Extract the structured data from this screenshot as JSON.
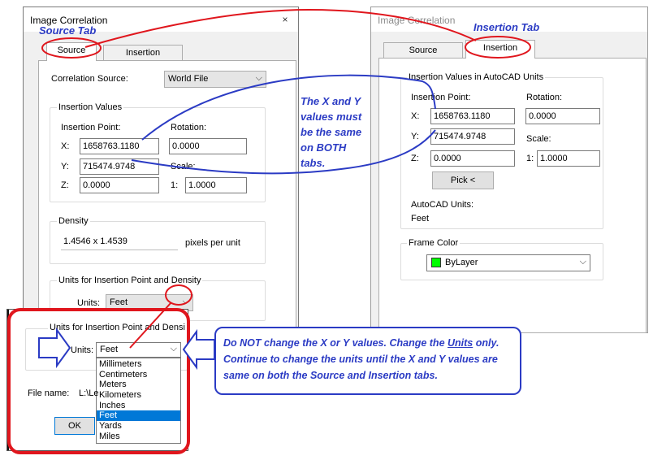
{
  "source_window": {
    "title": "Image Correlation",
    "close_glyph": "×",
    "tabs": [
      {
        "label": "Source",
        "active": true
      },
      {
        "label": "Insertion",
        "active": false
      }
    ],
    "correlation_source_label": "Correlation Source:",
    "correlation_source_value": "World File",
    "insertion_values": {
      "title": "Insertion Values",
      "point_label": "Insertion Point:",
      "x_label": "X:",
      "x_value": "1658763.1180",
      "y_label": "Y:",
      "y_value": "715474.9748",
      "z_label": "Z:",
      "z_value": "0.0000",
      "rotation_label": "Rotation:",
      "rotation_value": "0.0000",
      "scale_label": "Scale:",
      "scale_prefix": "1:",
      "scale_value": "1.0000"
    },
    "density": {
      "title": "Density",
      "value": "1.4546 x 1.4539",
      "unit": "pixels per unit"
    },
    "units_group": {
      "title": "Units for Insertion Point and Density",
      "label": "Units:",
      "value": "Feet"
    }
  },
  "insertion_window": {
    "title": "Image Correlation",
    "tabs": [
      {
        "label": "Source",
        "active": false
      },
      {
        "label": "Insertion",
        "active": true
      }
    ],
    "group_title": "Insertion Values in AutoCAD Units",
    "point_label": "Insertion Point:",
    "x_label": "X:",
    "x_value": "1658763.1180",
    "y_label": "Y:",
    "y_value": "715474.9748",
    "z_label": "Z:",
    "z_value": "0.0000",
    "rotation_label": "Rotation:",
    "rotation_value": "0.0000",
    "scale_label": "Scale:",
    "scale_prefix": "1:",
    "scale_value": "1.0000",
    "pick_button": "Pick <",
    "autocad_units_label": "AutoCAD Units:",
    "autocad_units_value": "Feet",
    "frame_color": {
      "title": "Frame Color",
      "value": "ByLayer",
      "swatch_color": "#00ff00"
    }
  },
  "zoom_inset": {
    "group_title": "Units for Insertion Point and Densi",
    "units_label": "Units:",
    "selected_value": "Feet",
    "options": [
      "Millimeters",
      "Centimeters",
      "Meters",
      "Kilometers",
      "Inches",
      "Feet",
      "Yards",
      "Miles"
    ],
    "selected_index": 5,
    "file_name_label": "File name:",
    "file_name_value": "L:\\Le",
    "ok_button": "OK"
  },
  "annotations": {
    "source_tab_caption": "Source Tab",
    "insertion_tab_caption": "Insertion Tab",
    "xy_note": [
      "The X and Y",
      "values must",
      "be the same",
      "on BOTH",
      "tabs."
    ],
    "callout_pre": "Do NOT change the X or Y values. Change the ",
    "callout_em": "Units",
    "callout_post": " only. Continue to change the units until the X and Y values are same on both the Source and Insertion tabs.",
    "annotation_color": "#2b3bc4",
    "highlight_color": "#e0161d"
  }
}
